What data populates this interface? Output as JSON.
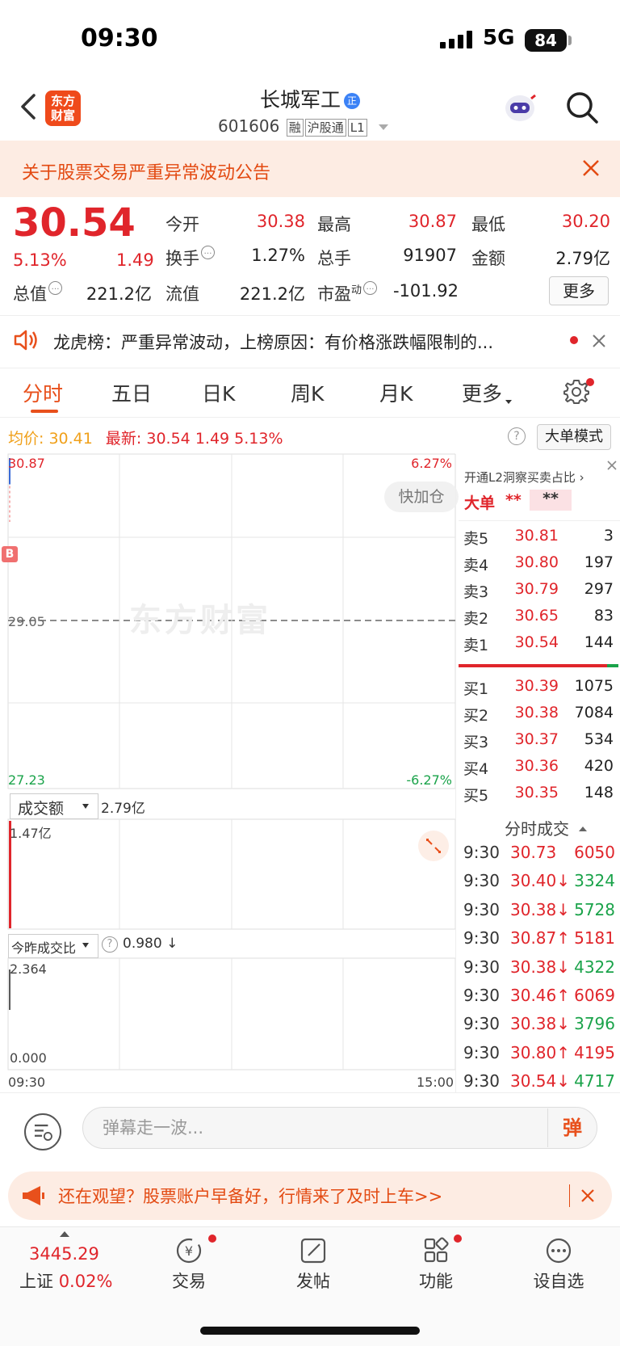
{
  "status": {
    "time": "09:30",
    "network": "5G",
    "battery": "84"
  },
  "header": {
    "logo_text": "东方财富",
    "stock_name": "长城军工",
    "badge": "正",
    "code": "601606",
    "tags": [
      "融",
      "沪股通",
      "L1"
    ]
  },
  "notice": {
    "text": "关于股票交易严重异常波动公告"
  },
  "quote": {
    "price": "30.54",
    "pct": "5.13%",
    "change": "1.49",
    "labels": {
      "open": "今开",
      "high": "最高",
      "low": "最低",
      "turnover": "换手",
      "volume": "总手",
      "amount": "金额",
      "mktcap": "总值",
      "float": "流值",
      "pe": "市盈",
      "pe_sup": "动"
    },
    "values": {
      "open": "30.38",
      "high": "30.87",
      "low": "30.20",
      "turnover": "1.27%",
      "volume": "91907",
      "amount": "2.79亿",
      "mktcap": "221.2亿",
      "float": "221.2亿",
      "pe": "-101.92"
    },
    "more_label": "更多"
  },
  "lhb": {
    "text": "龙虎榜：严重异常波动，上榜原因：有价格涨跌幅限制的..."
  },
  "tabs": [
    "分时",
    "五日",
    "日K",
    "周K",
    "月K",
    "更多"
  ],
  "infoline": {
    "avg_label": "均价:",
    "avg": "30.41",
    "last_label": "最新:",
    "last": "30.54",
    "change": "1.49",
    "pct": "5.13%",
    "help": "?",
    "big_mode": "大单模式"
  },
  "chart": {
    "max_price": "30.87",
    "max_pct": "6.27%",
    "pre_close": "29.05",
    "min_price": "27.23",
    "min_pct": "-6.27%",
    "watermark": "东方财富",
    "fast_add": "快加仓",
    "b_marker": "B",
    "vol_selector": "成交额",
    "vol_total": "2.79亿",
    "vol_max": "1.47亿",
    "ratio_selector": "今昨成交比",
    "ratio_value": "0.980 ↓",
    "ratio_max": "2.364",
    "ratio_min": "0.000",
    "time_start": "09:30",
    "time_end": "15:00"
  },
  "chart_data": {
    "type": "line",
    "x": [
      "09:30"
    ],
    "series": [
      {
        "values": [
          30.54
        ]
      }
    ],
    "ylim": [
      27.23,
      30.87
    ]
  },
  "orderbook": {
    "l2_ad": "开通L2洞察买卖占比 ›",
    "big_order_label": "大单",
    "big_order_v1": "**",
    "big_order_v2": "**",
    "asks": [
      {
        "label": "卖5",
        "price": "30.81",
        "vol": "3"
      },
      {
        "label": "卖4",
        "price": "30.80",
        "vol": "197"
      },
      {
        "label": "卖3",
        "price": "30.79",
        "vol": "297"
      },
      {
        "label": "卖2",
        "price": "30.65",
        "vol": "83"
      },
      {
        "label": "卖1",
        "price": "30.54",
        "vol": "144"
      }
    ],
    "bids": [
      {
        "label": "买1",
        "price": "30.39",
        "vol": "1075"
      },
      {
        "label": "买2",
        "price": "30.38",
        "vol": "7084"
      },
      {
        "label": "买3",
        "price": "30.37",
        "vol": "534"
      },
      {
        "label": "买4",
        "price": "30.36",
        "vol": "420"
      },
      {
        "label": "买5",
        "price": "30.35",
        "vol": "148"
      }
    ],
    "ticks_title": "分时成交",
    "ticks": [
      {
        "time": "9:30",
        "price": "30.73",
        "dir": "",
        "vol": "6050",
        "pc": "red",
        "vc": "red"
      },
      {
        "time": "9:30",
        "price": "30.40↓",
        "dir": "",
        "vol": "3324",
        "pc": "red",
        "vc": "green"
      },
      {
        "time": "9:30",
        "price": "30.38↓",
        "dir": "",
        "vol": "5728",
        "pc": "red",
        "vc": "green"
      },
      {
        "time": "9:30",
        "price": "30.87↑",
        "dir": "",
        "vol": "5181",
        "pc": "red",
        "vc": "red"
      },
      {
        "time": "9:30",
        "price": "30.38↓",
        "dir": "",
        "vol": "4322",
        "pc": "red",
        "vc": "green"
      },
      {
        "time": "9:30",
        "price": "30.46↑",
        "dir": "",
        "vol": "6069",
        "pc": "red",
        "vc": "red"
      },
      {
        "time": "9:30",
        "price": "30.38↓",
        "dir": "",
        "vol": "3796",
        "pc": "red",
        "vc": "green"
      },
      {
        "time": "9:30",
        "price": "30.80↑",
        "dir": "",
        "vol": "4195",
        "pc": "red",
        "vc": "red"
      },
      {
        "time": "9:30",
        "price": "30.54↓",
        "dir": "",
        "vol": "4717",
        "pc": "red",
        "vc": "green"
      }
    ]
  },
  "danmu": {
    "placeholder": "弹幕走一波...",
    "send": "弹"
  },
  "promo": {
    "text": "还在观望？股票账户早备好，行情来了及时上车>>"
  },
  "bottom_nav": {
    "index_value": "3445.29",
    "index_name": "上证",
    "index_pct": "0.02%",
    "items": [
      "交易",
      "发帖",
      "功能",
      "设自选"
    ]
  }
}
